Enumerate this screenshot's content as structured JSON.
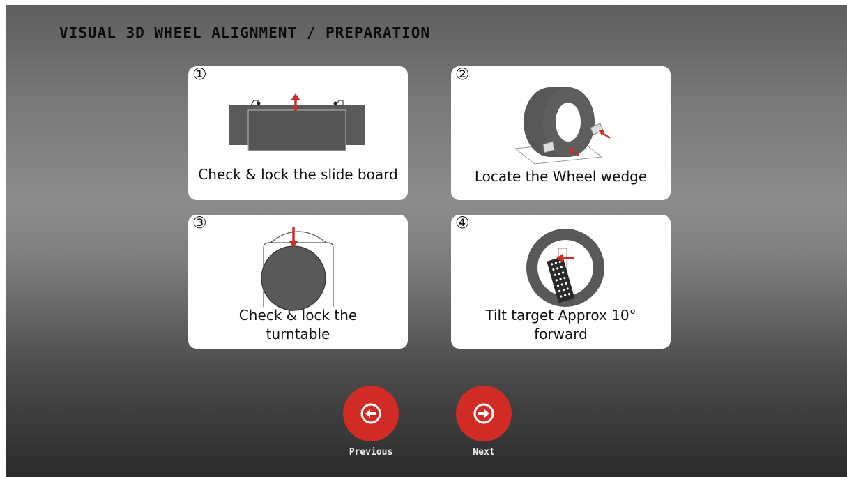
{
  "header": {
    "title": "VISUAL 3D WHEEL ALIGNMENT / PREPARATION"
  },
  "steps": [
    {
      "number": "①",
      "caption": "Check & lock the slide board",
      "icon": "slide-board-icon"
    },
    {
      "number": "②",
      "caption": "Locate the Wheel wedge",
      "icon": "wheel-wedge-icon"
    },
    {
      "number": "③",
      "caption": "Check & lock the turntable",
      "icon": "turntable-icon"
    },
    {
      "number": "④",
      "caption": "Tilt target Approx 10° forward",
      "icon": "tilt-target-icon"
    }
  ],
  "nav": {
    "previous_label": "Previous",
    "next_label": "Next"
  },
  "colors": {
    "accent": "#d12b26",
    "card": "#ffffff",
    "illustration": "#595959"
  }
}
